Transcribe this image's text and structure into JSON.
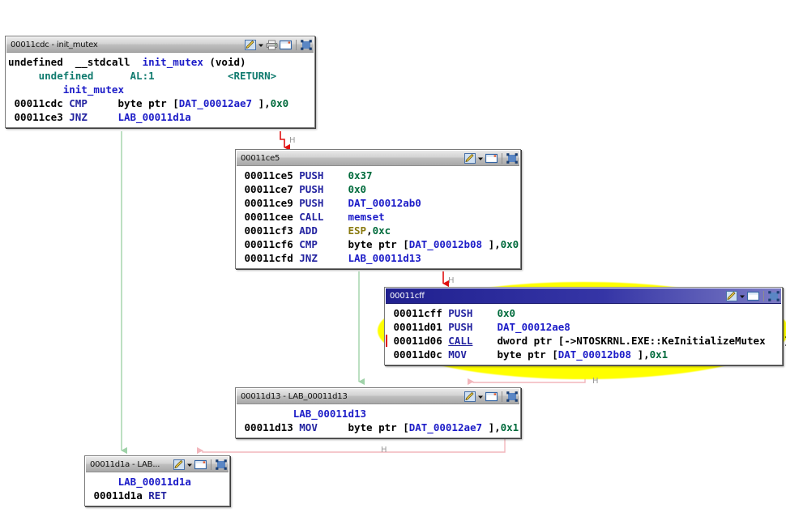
{
  "app": {
    "name": "function-graph-view",
    "function_name": "init_mutex"
  },
  "icons": {
    "edit": "pencil-edit-icon",
    "dropdown": "chevron-down-icon",
    "snapshot": "printer-snapshot-icon",
    "window": "window-icon",
    "fit": "fit-to-window-icon"
  },
  "blocks": [
    {
      "id": "block-00011cdc",
      "title": "00011cdc - init_mutex",
      "active": false,
      "has_snapshot_icon": true,
      "lines": [
        {
          "name": "signature-line",
          "tokens": [
            {
              "text": "undefined  ",
              "cls": "t-type"
            },
            {
              "text": "__stdcall  ",
              "cls": "t-plain"
            },
            {
              "text": "init_mutex",
              "cls": "t-fnname"
            },
            {
              "text": " (void)",
              "cls": "t-plain"
            }
          ]
        },
        {
          "name": "return-line",
          "tokens": [
            {
              "text": "     undefined      ",
              "cls": "t-param"
            },
            {
              "text": "AL:1",
              "cls": "t-param"
            },
            {
              "text": "            ",
              "cls": "t-plain"
            },
            {
              "text": "<RETURN>",
              "cls": "t-ret"
            }
          ]
        },
        {
          "name": "label-line",
          "tokens": [
            {
              "text": "         init_mutex",
              "cls": "t-label"
            }
          ]
        },
        {
          "name": "instruction-00011cdc",
          "tokens": [
            {
              "text": " 00011cdc ",
              "cls": "t-addr"
            },
            {
              "text": "CMP",
              "cls": "t-mnem"
            },
            {
              "text": "     byte ptr [",
              "cls": "t-plain"
            },
            {
              "text": "DAT_00012ae7",
              "cls": "t-sym"
            },
            {
              "text": " ],",
              "cls": "t-plain"
            },
            {
              "text": "0x0",
              "cls": "t-num"
            }
          ]
        },
        {
          "name": "instruction-00011ce3",
          "tokens": [
            {
              "text": " 00011ce3 ",
              "cls": "t-addr"
            },
            {
              "text": "JNZ",
              "cls": "t-mnem"
            },
            {
              "text": "     ",
              "cls": "t-plain"
            },
            {
              "text": "LAB_00011d1a",
              "cls": "t-sym"
            }
          ]
        }
      ]
    },
    {
      "id": "block-00011ce5",
      "title": "00011ce5",
      "active": false,
      "has_snapshot_icon": false,
      "lines": [
        {
          "name": "instruction-00011ce5",
          "tokens": [
            {
              "text": " 00011ce5 ",
              "cls": "t-addr"
            },
            {
              "text": "PUSH",
              "cls": "t-mnem"
            },
            {
              "text": "    ",
              "cls": "t-plain"
            },
            {
              "text": "0x37",
              "cls": "t-num"
            }
          ]
        },
        {
          "name": "instruction-00011ce7",
          "tokens": [
            {
              "text": " 00011ce7 ",
              "cls": "t-addr"
            },
            {
              "text": "PUSH",
              "cls": "t-mnem"
            },
            {
              "text": "    ",
              "cls": "t-plain"
            },
            {
              "text": "0x0",
              "cls": "t-num"
            }
          ]
        },
        {
          "name": "instruction-00011ce9",
          "tokens": [
            {
              "text": " 00011ce9 ",
              "cls": "t-addr"
            },
            {
              "text": "PUSH",
              "cls": "t-mnem"
            },
            {
              "text": "    ",
              "cls": "t-plain"
            },
            {
              "text": "DAT_00012ab0",
              "cls": "t-sym"
            }
          ]
        },
        {
          "name": "instruction-00011cee",
          "tokens": [
            {
              "text": " 00011cee ",
              "cls": "t-addr"
            },
            {
              "text": "CALL",
              "cls": "t-mnem"
            },
            {
              "text": "    ",
              "cls": "t-plain"
            },
            {
              "text": "memset",
              "cls": "t-call"
            }
          ]
        },
        {
          "name": "instruction-00011cf3",
          "tokens": [
            {
              "text": " 00011cf3 ",
              "cls": "t-addr"
            },
            {
              "text": "ADD",
              "cls": "t-mnem"
            },
            {
              "text": "     ",
              "cls": "t-plain"
            },
            {
              "text": "ESP",
              "cls": "t-reg"
            },
            {
              "text": ",",
              "cls": "t-plain"
            },
            {
              "text": "0xc",
              "cls": "t-num"
            }
          ]
        },
        {
          "name": "instruction-00011cf6",
          "tokens": [
            {
              "text": " 00011cf6 ",
              "cls": "t-addr"
            },
            {
              "text": "CMP",
              "cls": "t-mnem"
            },
            {
              "text": "     byte ptr [",
              "cls": "t-plain"
            },
            {
              "text": "DAT_00012b08",
              "cls": "t-sym"
            },
            {
              "text": " ],",
              "cls": "t-plain"
            },
            {
              "text": "0x0",
              "cls": "t-num"
            }
          ]
        },
        {
          "name": "instruction-00011cfd",
          "tokens": [
            {
              "text": " 00011cfd ",
              "cls": "t-addr"
            },
            {
              "text": "JNZ",
              "cls": "t-mnem"
            },
            {
              "text": "     ",
              "cls": "t-plain"
            },
            {
              "text": "LAB_00011d13",
              "cls": "t-sym"
            }
          ]
        }
      ]
    },
    {
      "id": "block-00011cff",
      "title": "00011cff",
      "active": true,
      "has_snapshot_icon": false,
      "lines": [
        {
          "name": "instruction-00011cff",
          "tokens": [
            {
              "text": " 00011cff ",
              "cls": "t-addr"
            },
            {
              "text": "PUSH",
              "cls": "t-mnem"
            },
            {
              "text": "    ",
              "cls": "t-plain"
            },
            {
              "text": "0x0",
              "cls": "t-num"
            }
          ]
        },
        {
          "name": "instruction-00011d01",
          "tokens": [
            {
              "text": " 00011d01 ",
              "cls": "t-addr"
            },
            {
              "text": "PUSH",
              "cls": "t-mnem"
            },
            {
              "text": "    ",
              "cls": "t-plain"
            },
            {
              "text": "DAT_00012ae8",
              "cls": "t-sym"
            }
          ]
        },
        {
          "name": "instruction-00011d06",
          "cursor": true,
          "tokens": [
            {
              "text": " 00011d06 ",
              "cls": "t-addr"
            },
            {
              "text": "CALL",
              "cls": "t-mnem-u"
            },
            {
              "text": "    dword ptr [->NTOSKRNL.EXE::KeInitializeMutex   ]",
              "cls": "t-plain"
            }
          ]
        },
        {
          "name": "instruction-00011d0c",
          "tokens": [
            {
              "text": " 00011d0c ",
              "cls": "t-addr"
            },
            {
              "text": "MOV",
              "cls": "t-mnem"
            },
            {
              "text": "     byte ptr [",
              "cls": "t-plain"
            },
            {
              "text": "DAT_00012b08",
              "cls": "t-sym"
            },
            {
              "text": " ],",
              "cls": "t-plain"
            },
            {
              "text": "0x1",
              "cls": "t-num"
            }
          ]
        }
      ]
    },
    {
      "id": "block-00011d13",
      "title": "00011d13 - LAB_00011d13",
      "active": false,
      "has_snapshot_icon": false,
      "lines": [
        {
          "name": "label-line",
          "tokens": [
            {
              "text": "         LAB_00011d13",
              "cls": "t-label"
            }
          ]
        },
        {
          "name": "instruction-00011d13",
          "tokens": [
            {
              "text": " 00011d13 ",
              "cls": "t-addr"
            },
            {
              "text": "MOV",
              "cls": "t-mnem"
            },
            {
              "text": "     byte ptr [",
              "cls": "t-plain"
            },
            {
              "text": "DAT_00012ae7",
              "cls": "t-sym"
            },
            {
              "text": " ],",
              "cls": "t-plain"
            },
            {
              "text": "0x1",
              "cls": "t-num"
            }
          ]
        }
      ]
    },
    {
      "id": "block-00011d1a",
      "title": "00011d1a - LAB...",
      "active": false,
      "has_snapshot_icon": false,
      "lines": [
        {
          "name": "label-line",
          "tokens": [
            {
              "text": "     LAB_00011d1a",
              "cls": "t-label"
            }
          ]
        },
        {
          "name": "instruction-00011d1a",
          "tokens": [
            {
              "text": " 00011d1a ",
              "cls": "t-addr"
            },
            {
              "text": "RET",
              "cls": "t-mnem"
            }
          ]
        }
      ]
    }
  ],
  "edge_markers": [
    {
      "name": "edge-marker-1",
      "text": "H"
    },
    {
      "name": "edge-marker-2",
      "text": "H"
    },
    {
      "name": "edge-marker-3",
      "text": "H"
    },
    {
      "name": "edge-marker-4",
      "text": "H"
    }
  ],
  "colors": {
    "fallthrough_edge": "#e01010",
    "branch_edge": "#9fd2a8",
    "return_edge": "#f2b6bc",
    "highlight_glow": "#ffff00",
    "active_title": "#20208f"
  }
}
